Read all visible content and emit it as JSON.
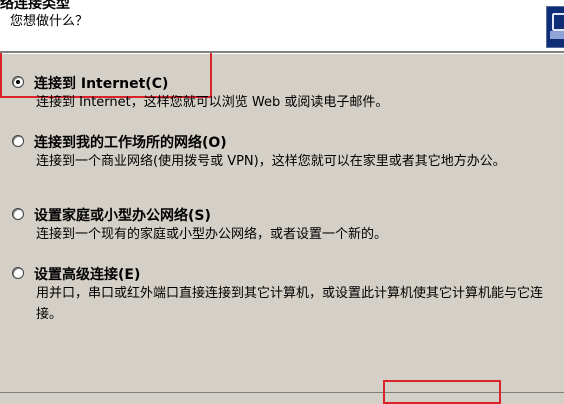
{
  "header": {
    "title": "络连接类型",
    "subtitle": "您想做什么？"
  },
  "options": [
    {
      "label": "连接到 Internet(C)",
      "description": "连接到 Internet，这样您就可以浏览 Web 或阅读电子邮件。",
      "selected": true
    },
    {
      "label": "连接到我的工作场所的网络(O)",
      "description": "连接到一个商业网络(使用拨号或 VPN)，这样您就可以在家里或者其它地方办公。",
      "selected": false
    },
    {
      "label": "设置家庭或小型办公网络(S)",
      "description": "连接到一个现有的家庭或小型办公网络，或者设置一个新的。",
      "selected": false
    },
    {
      "label": "设置高级连接(E)",
      "description": "用并口，串口或红外端口直接连接到其它计算机，或设置此计算机使其它计算机能与它连接。",
      "selected": false
    }
  ],
  "icons": {
    "wizard": "network-wizard-icon"
  },
  "colors": {
    "dialog_background": "#d4d0c8",
    "header_background": "#ffffff",
    "annotation_red": "#d9222a",
    "icon_blue": "#0e2d76"
  }
}
